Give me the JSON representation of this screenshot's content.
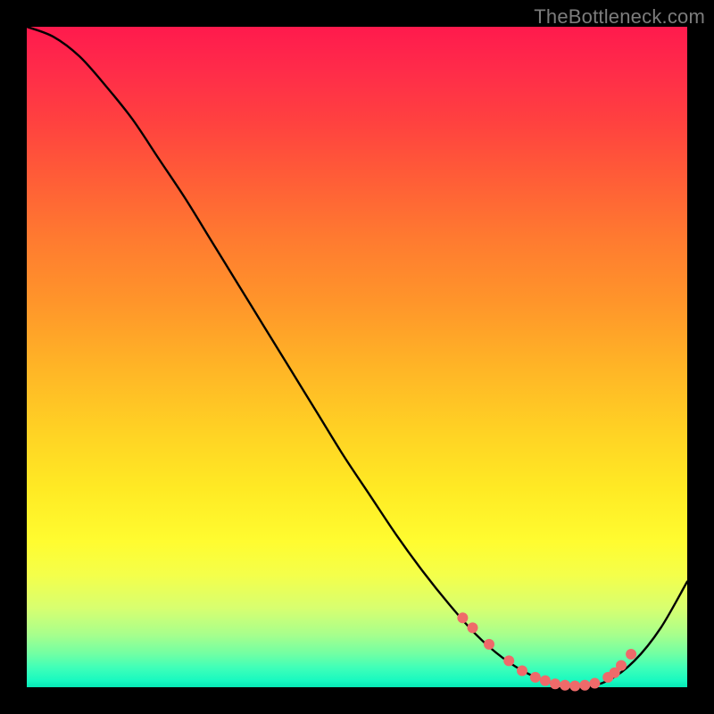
{
  "watermark": "TheBottleneck.com",
  "chart_data": {
    "type": "line",
    "title": "",
    "xlabel": "",
    "ylabel": "",
    "xlim": [
      0,
      100
    ],
    "ylim": [
      0,
      100
    ],
    "grid": false,
    "legend": false,
    "series": [
      {
        "name": "bottleneck-curve",
        "x": [
          0,
          4,
          8,
          12,
          16,
          20,
          24,
          28,
          32,
          36,
          40,
          44,
          48,
          52,
          56,
          60,
          64,
          68,
          72,
          76,
          80,
          84,
          88,
          92,
          96,
          100
        ],
        "y": [
          100,
          98.5,
          95.5,
          91,
          86,
          80,
          74,
          67.5,
          61,
          54.5,
          48,
          41.5,
          35,
          29,
          23,
          17.5,
          12.5,
          8,
          4.5,
          2,
          0.5,
          0,
          1,
          4,
          9,
          16
        ]
      }
    ],
    "markers": {
      "name": "highlight-points",
      "color": "#ef6a6a",
      "radius_px": 6,
      "x": [
        66,
        67.5,
        70,
        73,
        75,
        77,
        78.5,
        80,
        81.5,
        83,
        84.5,
        86,
        88,
        89,
        90,
        91.5
      ],
      "y": [
        10.5,
        9,
        6.5,
        4,
        2.5,
        1.5,
        1,
        0.5,
        0.3,
        0.2,
        0.3,
        0.6,
        1.5,
        2.2,
        3.3,
        5.0
      ]
    }
  }
}
